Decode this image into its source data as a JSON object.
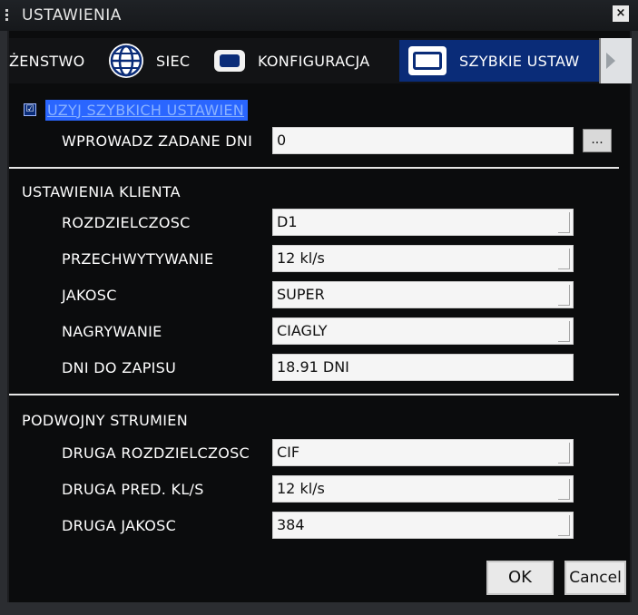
{
  "window": {
    "title": "USTAWIENIA",
    "close_label": "×"
  },
  "tabs": [
    {
      "label": "ŻENSTWO",
      "icon": "none"
    },
    {
      "label": "SIEC",
      "icon": "globe-icon"
    },
    {
      "label": "KONFIGURACJA",
      "icon": "config-icon"
    },
    {
      "label": "SZYBKIE USTAW",
      "icon": "folder-search-icon",
      "active": true
    }
  ],
  "quick": {
    "checkbox_label": "UZYJ SZYBKICH USTAWIEN",
    "checked": true,
    "checkmark": "☑",
    "days_label": "WPROWADZ ZADANE DNI",
    "days_value": "0",
    "browse_label": "..."
  },
  "client": {
    "section": "USTAWIENIA KLIENTA",
    "resolution_label": "ROZDZIELCZOSC",
    "resolution_value": "D1",
    "capture_label": "PRZECHWYTYWANIE",
    "capture_value": "12 kl/s",
    "quality_label": "JAKOSC",
    "quality_value": "SUPER",
    "record_label": "NAGRYWANIE",
    "record_value": "CIAGLY",
    "days_label": "DNI DO ZAPISU",
    "days_value": "18.91 DNI"
  },
  "dual": {
    "section": "PODWOJNY STRUMIEN",
    "resolution_label": "DRUGA ROZDZIELCZOSC",
    "resolution_value": "CIF",
    "fps_label": "DRUGA PRED. KL/S",
    "fps_value": "12 kl/s",
    "quality_label": "DRUGA JAKOSC",
    "quality_value": "384"
  },
  "buttons": {
    "ok": "OK",
    "cancel": "Cancel"
  },
  "colors": {
    "accent": "#0a2c78",
    "highlight": "#2a66ff",
    "panel": "#0b0c0d"
  }
}
